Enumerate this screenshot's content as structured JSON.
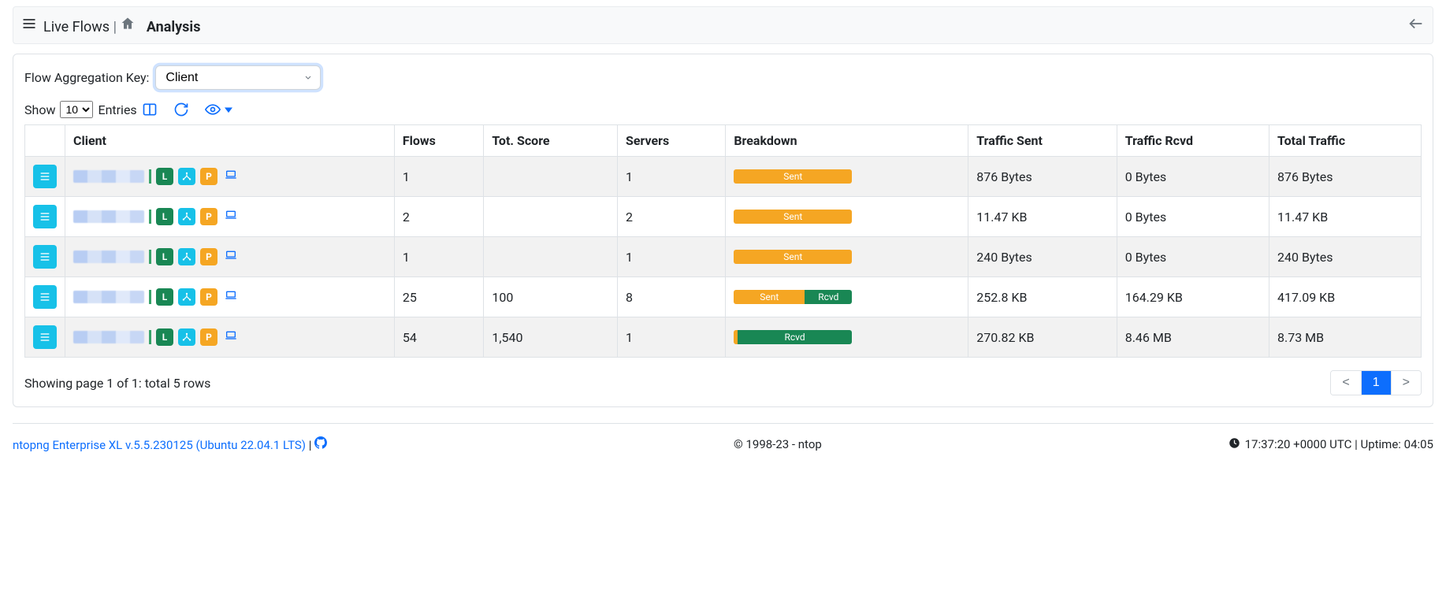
{
  "header": {
    "section": "Live Flows",
    "page": "Analysis"
  },
  "agg": {
    "label": "Flow Aggregation Key:",
    "value": "Client"
  },
  "show": {
    "prefix": "Show",
    "value": "10",
    "suffix": "Entries"
  },
  "columns": [
    "",
    "Client",
    "Flows",
    "Tot. Score",
    "Servers",
    "Breakdown",
    "Traffic Sent",
    "Traffic Rcvd",
    "Total Traffic"
  ],
  "breakdown_labels": {
    "sent": "Sent",
    "rcvd": "Rcvd"
  },
  "rows": [
    {
      "flows": "1",
      "score": "",
      "servers": "1",
      "sent_pct": 100,
      "sent": "876 Bytes",
      "rcvd": "0 Bytes",
      "total": "876 Bytes"
    },
    {
      "flows": "2",
      "score": "",
      "servers": "2",
      "sent_pct": 100,
      "sent": "11.47 KB",
      "rcvd": "0 Bytes",
      "total": "11.47 KB"
    },
    {
      "flows": "1",
      "score": "",
      "servers": "1",
      "sent_pct": 100,
      "sent": "240 Bytes",
      "rcvd": "0 Bytes",
      "total": "240 Bytes"
    },
    {
      "flows": "25",
      "score": "100",
      "servers": "8",
      "sent_pct": 60,
      "sent": "252.8 KB",
      "rcvd": "164.29 KB",
      "total": "417.09 KB"
    },
    {
      "flows": "54",
      "score": "1,540",
      "servers": "1",
      "sent_pct": 3,
      "sent": "270.82 KB",
      "rcvd": "8.46 MB",
      "total": "8.73 MB"
    }
  ],
  "badge_labels": {
    "L": "L",
    "P": "P"
  },
  "pager_text": "Showing page 1 of 1: total 5 rows",
  "pager": {
    "prev": "<",
    "current": "1",
    "next": ">"
  },
  "footer": {
    "version": "ntopng Enterprise XL v.5.5.230125 (Ubuntu 22.04.1 LTS)",
    "copyright": "© 1998-23 - ntop",
    "clock": "17:37:20 +0000 UTC | Uptime: 04:05"
  }
}
